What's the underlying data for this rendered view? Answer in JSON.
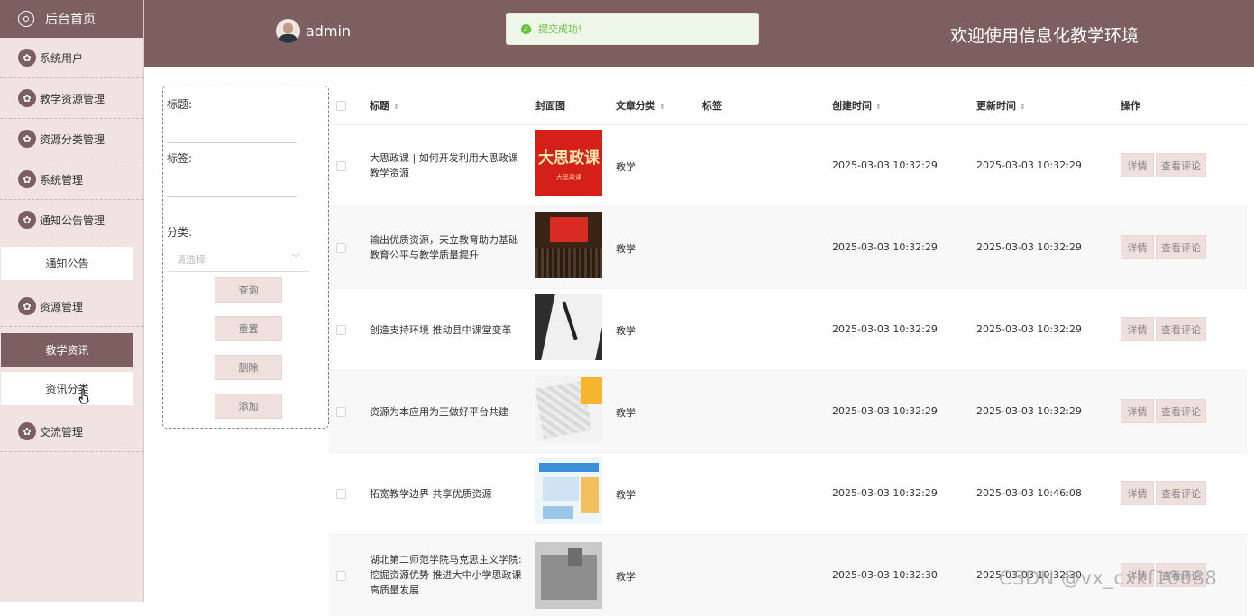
{
  "sidebar": {
    "home": "后台首页",
    "system_users": "系统用户",
    "teaching_resource_mgmt": "教学资源管理",
    "resource_category_mgmt": "资源分类管理",
    "system_mgmt": "系统管理",
    "notice_mgmt": "通知公告管理",
    "notice": "通知公告",
    "resource_mgmt": "资源管理",
    "teaching_news": "教学资讯",
    "news_category": "资讯分类",
    "exchange_mgmt": "交流管理"
  },
  "header": {
    "username": "admin",
    "welcome": "欢迎使用信息化教学环境"
  },
  "toast": {
    "message": "提交成功!"
  },
  "filter": {
    "title_label": "标题:",
    "tag_label": "标签:",
    "category_label": "分类:",
    "category_placeholder": "请选择",
    "query": "查询",
    "reset": "重置",
    "delete": "删除",
    "add": "添加"
  },
  "table": {
    "columns": {
      "title": "标题",
      "cover": "封面图",
      "category": "文章分类",
      "tag": "标签",
      "created": "创建时间",
      "updated": "更新时间",
      "action": "操作"
    },
    "detail_label": "详情",
    "comments_label": "查看评论",
    "rows": [
      {
        "title": "大思政课 | 如何开发利用大思政课教学资源",
        "category": "教学",
        "tag": "",
        "created": "2025-03-03 10:32:29",
        "updated": "2025-03-03 10:32:29",
        "cover_text": "大思政课",
        "cover_sub": "大思政课"
      },
      {
        "title": "输出优质资源，天立教育助力基础教育公平与教学质量提升",
        "category": "教学",
        "tag": "",
        "created": "2025-03-03 10:32:29",
        "updated": "2025-03-03 10:32:29"
      },
      {
        "title": "创造支持环境 推动县中课堂变革",
        "category": "教学",
        "tag": "",
        "created": "2025-03-03 10:32:29",
        "updated": "2025-03-03 10:32:29"
      },
      {
        "title": "资源为本应用为王做好平台共建",
        "category": "教学",
        "tag": "",
        "created": "2025-03-03 10:32:29",
        "updated": "2025-03-03 10:32:29"
      },
      {
        "title": "拓宽教学边界 共享优质资源",
        "category": "教学",
        "tag": "",
        "created": "2025-03-03 10:32:29",
        "updated": "2025-03-03 10:46:08"
      },
      {
        "title": "湖北第二师范学院马克思主义学院:挖掘资源优势 推进大中小学思政课高质量发展",
        "category": "教学",
        "tag": "",
        "created": "2025-03-03 10:32:30",
        "updated": "2025-03-03 10:32:30"
      }
    ]
  },
  "watermark": "CSDN @vx_cxkf10088",
  "colors": {
    "primary": "#7e5f5f",
    "sidebar_bg": "#f0e3e1",
    "button_bg": "#efe0de",
    "success": "#67c23a"
  }
}
